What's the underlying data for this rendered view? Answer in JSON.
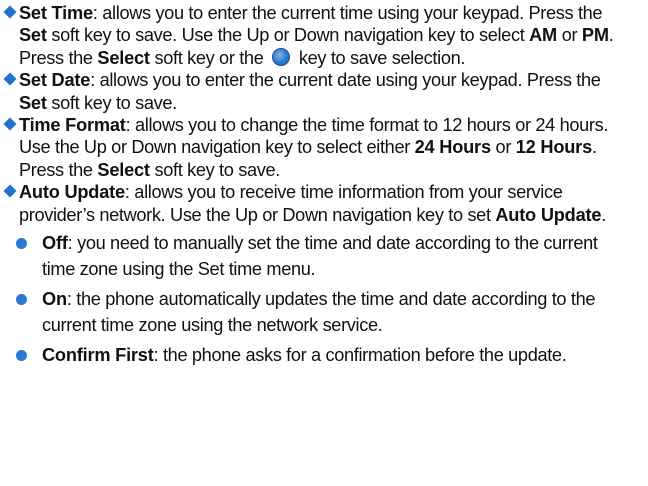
{
  "items": [
    {
      "term": "Set Time",
      "parts": [
        ": allows you to enter the current time using your keypad. Press the ",
        "Set",
        " soft key to save. Use the Up or Down navigation key to select ",
        "AM",
        " or ",
        "PM",
        ". Press the ",
        "Select",
        " soft key or the ",
        " key to save selection."
      ],
      "icon": "select-key-icon"
    },
    {
      "term": "Set Date",
      "parts": [
        ": allows you to enter the current date using your keypad. Press the ",
        "Set",
        " soft key to save."
      ]
    },
    {
      "term": "Time Format",
      "parts": [
        ": allows you to change the time format to 12 hours or 24 hours. Use the Up or Down navigation key to select either ",
        "24 Hours",
        " or ",
        "12 Hours",
        ". Press the ",
        "Select",
        " soft key to save."
      ]
    },
    {
      "term": "Auto Update",
      "parts": [
        ": allows you to receive time information from your service provider’s network. Use the Up or Down navigation key to set ",
        "Auto Update",
        "."
      ],
      "options": [
        {
          "term": "Off",
          "text": ": you need to manually set the time and date according to the current time zone using the Set time menu."
        },
        {
          "term": "On",
          "text": ": the phone automatically updates the time and date according to the current time zone using the network service."
        },
        {
          "term": "Confirm First",
          "text": ": the phone asks for a confirmation before the update."
        }
      ]
    }
  ],
  "colors": {
    "bullet": "#1f73c9",
    "text": "#111111"
  }
}
